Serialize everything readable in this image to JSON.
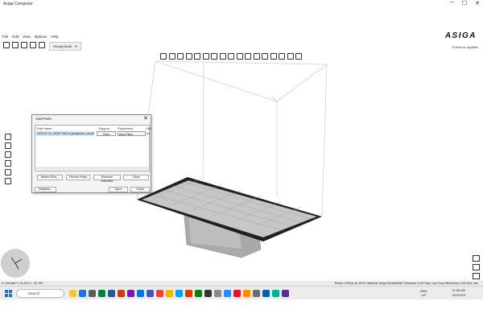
{
  "window": {
    "title": "Asiga Composer",
    "controls": [
      "─",
      "☐",
      "✕"
    ]
  },
  "menu": [
    "File",
    "Edit",
    "View",
    "Options",
    "Help"
  ],
  "brand": "ASIGA",
  "check_updates": "Check for updates",
  "tab": {
    "label": "*Empty Build",
    "close": "✕"
  },
  "add_parts": {
    "title": "Add Parts",
    "columns": [
      "Part name",
      "Support",
      "Placement",
      "Unit"
    ],
    "row": {
      "name": "2023-07-24_00067-006-16-lpdaeplant_cad.stl",
      "support": "Open",
      "placement": "Auto-Place",
      "unit": "mm"
    },
    "buttons": {
      "select_files": "Select Files...",
      "recent_parts": "Recent Parts",
      "remove_selected": "Remove Selected",
      "clear": "Clear",
      "defaults": "Defaults...",
      "open": "Open",
      "close": "Close"
    }
  },
  "status": {
    "coords": "X: 105.864  Y: 24.222  Z: -32.780",
    "printer": "Printer: ASIGA-4K-ASH7  Material: Asiga DentaBASE  Thickness: 0.05  Tray: Low Force  Build time: 0:00  Unit: mm"
  },
  "taskbar": {
    "search": "Search",
    "lang": "ENG\nUS",
    "time": "11:36 AM",
    "date": "8/1/2023"
  },
  "colors": {
    "platform": "#222222",
    "mesh": "#bdbdbd",
    "accent": "#1b76d2"
  }
}
